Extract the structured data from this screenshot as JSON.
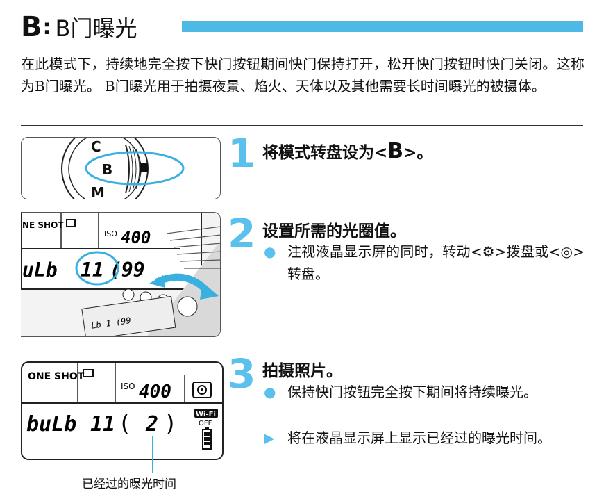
{
  "header": {
    "mode_letter": "B",
    "colon": ":",
    "title": "B门曝光"
  },
  "intro": "在此模式下，持续地完全按下快门按钮期间快门保持打开，松开快门按钮时快门关闭。这称为B门曝光。 B门曝光用于拍摄夜景、焰火、天体以及其他需要长时间曝光的被摄体。",
  "steps": [
    {
      "number": "1",
      "title_prefix": "将模式转盘设为<",
      "title_symbol": "B",
      "title_suffix": ">。"
    },
    {
      "number": "2",
      "title": "设置所需的光圈值。",
      "bullets": [
        {
          "mark": "●",
          "text": "注视液晶显示屏的同时，转动<⚙>拨盘或<◎>转盘。"
        }
      ]
    },
    {
      "number": "3",
      "title": "拍摄照片。",
      "bullets": [
        {
          "mark": "●",
          "text": "保持快门按钮完全按下期间将持续曝光。"
        },
        {
          "mark": "▶",
          "text": "将在液晶显示屏上显示已经过的曝光时间。"
        }
      ]
    }
  ],
  "dial_image": {
    "labels": [
      "C",
      "B",
      "M"
    ]
  },
  "lcd_photo": {
    "mode": "NE SHOT",
    "iso_label": "ISO",
    "iso_value": "400",
    "bulb_text": "uLb",
    "aperture": "11",
    "partial": "(99",
    "small_panel": "Lb 1 (99"
  },
  "lcd_display": {
    "mode": "ONE SHOT",
    "iso_label": "ISO",
    "iso_value": "400",
    "bulb_text": "buLb",
    "aperture": "11",
    "elapsed": "2",
    "wifi": "Wi-Fi",
    "wifi_state": "OFF"
  },
  "caption": "已经过的曝光时间",
  "colors": {
    "accent": "#5bc0eb",
    "title_bar": "#4fb9e6",
    "text": "#111111"
  }
}
